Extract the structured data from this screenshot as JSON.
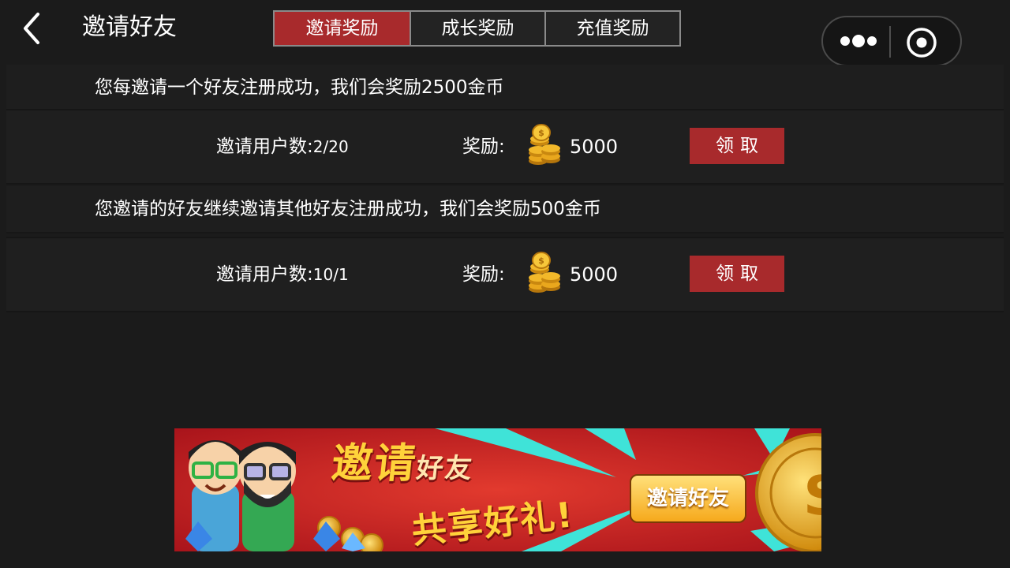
{
  "header": {
    "title": "邀请好友",
    "tabs": [
      {
        "label": "邀请奖励",
        "active": true
      },
      {
        "label": "成长奖励",
        "active": false
      },
      {
        "label": "充值奖励",
        "active": false
      }
    ]
  },
  "rules": [
    {
      "description": "您每邀请一个好友注册成功，我们会奖励2500金币",
      "invite_label": "邀请用户数:",
      "invite_count": "2/20",
      "reward_label": "奖励:",
      "reward_amount": "5000",
      "claim_label": "领取"
    },
    {
      "description": "您邀请的好友继续邀请其他好友注册成功，我们会奖励500金币",
      "invite_label": "邀请用户数:",
      "invite_count": "10/1",
      "reward_label": "奖励:",
      "reward_amount": "5000",
      "claim_label": "领取"
    }
  ],
  "banner": {
    "title_main": "邀请",
    "title_small": "好友",
    "subtitle": "共享好礼!",
    "button_label": "邀请好友"
  },
  "colors": {
    "accent_red": "#a82a2c",
    "background": "#1b1b1b",
    "banner_gold": "#ffd23a"
  },
  "icons": {
    "back": "chevron-left-icon",
    "more": "more-dots-icon",
    "close": "target-close-icon",
    "coin": "gold-coins-icon"
  }
}
